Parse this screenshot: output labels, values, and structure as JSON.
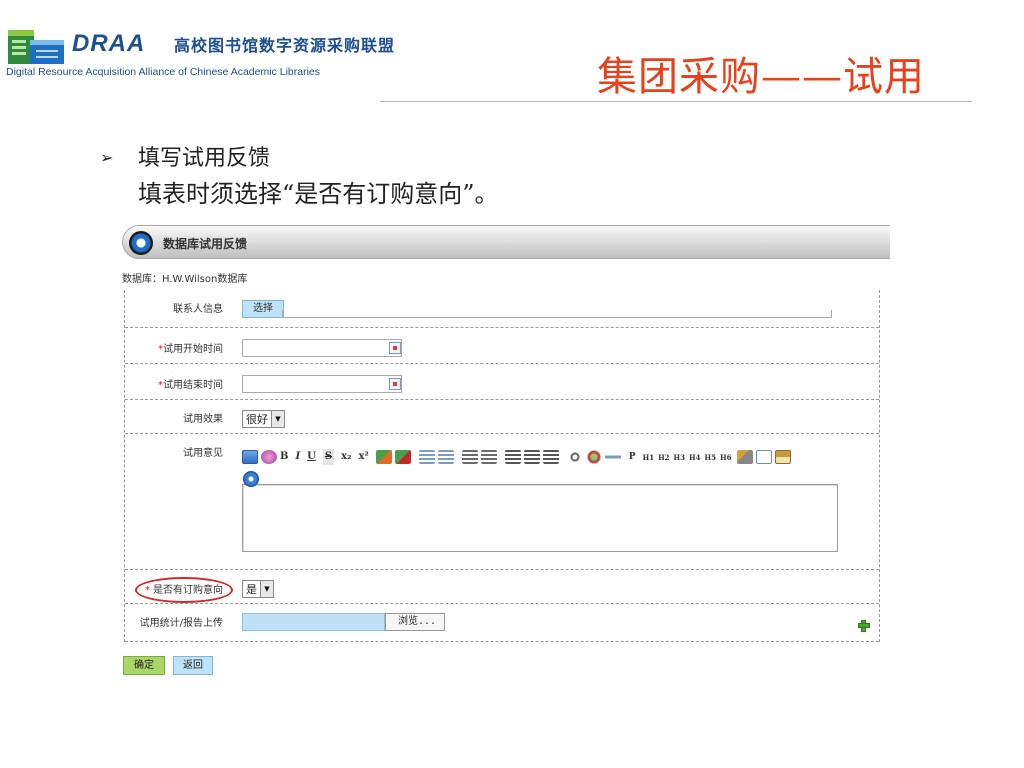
{
  "header": {
    "logo_abbr": "DRAA",
    "logo_cn": "高校图书馆数字资源采购联盟",
    "logo_en": "Digital Resource Acquisition Alliance of Chinese Academic Libraries",
    "slide_title": "集团采购——试用",
    "title_color": "#e8421c",
    "brand_color": "#1f4f8f"
  },
  "bullets": {
    "marker": "➢",
    "line1": "填写试用反馈",
    "line2": "填表时须选择“是否有订购意向”。"
  },
  "panel": {
    "title": "数据库试用反馈",
    "database_label": "数据库：",
    "database_value": "H.W.Wilson数据库"
  },
  "form": {
    "contact": {
      "label": "联系人信息",
      "button": "选择"
    },
    "start_date": {
      "required": "*",
      "label": "试用开始时间",
      "value": ""
    },
    "end_date": {
      "required": "*",
      "label": "试用结束时间",
      "value": ""
    },
    "effect": {
      "label": "试用效果",
      "selected": "很好"
    },
    "opinion": {
      "label": "试用意见",
      "toolbar": {
        "bold": "B",
        "italic": "I",
        "underline": "U",
        "strike": "S",
        "subscript": "x₂",
        "superscript": "x²",
        "paragraph": "P",
        "headings": [
          "H1",
          "H2",
          "H3",
          "H4",
          "H5",
          "H6"
        ]
      },
      "content": ""
    },
    "purchase_intent": {
      "required": "*",
      "label": "是否有订购意向",
      "selected": "是"
    },
    "upload": {
      "label": "试用统计/报告上传",
      "browse": "浏览..."
    }
  },
  "actions": {
    "ok": "确定",
    "back": "返回"
  },
  "colors": {
    "required_star": "#e01010",
    "highlight_circle": "#d62828",
    "ok_button": "#a8d668",
    "blue_button": "#bfe2f6"
  }
}
